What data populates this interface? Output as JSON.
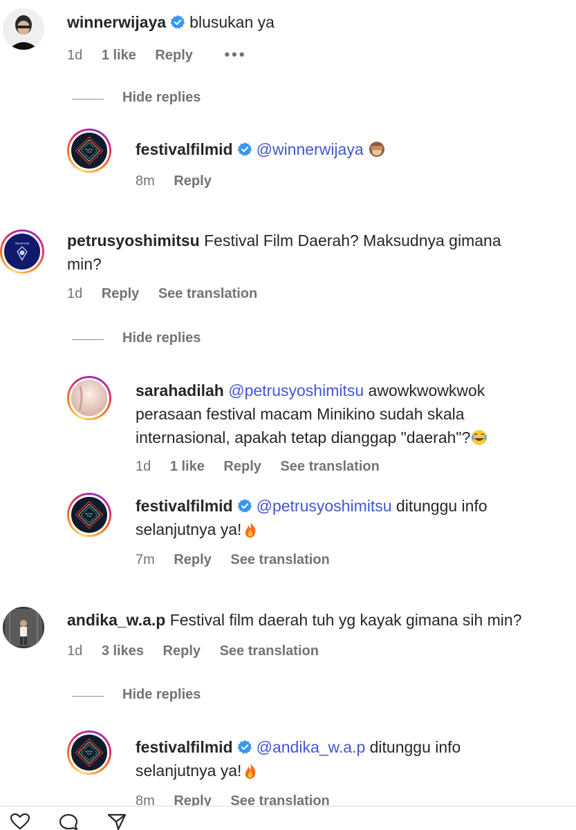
{
  "comments": [
    {
      "username": "winnerwijaya",
      "verified": true,
      "text": "blusukan ya",
      "time": "1d",
      "likes": "1 like",
      "reply": "Reply",
      "more": "•••",
      "hide_replies": "Hide replies",
      "replies": [
        {
          "username": "festivalfilmid",
          "verified": true,
          "mention": "@winnerwijaya",
          "text": "",
          "emoji": "see-no-evil-monkey",
          "time": "8m",
          "reply": "Reply"
        }
      ]
    },
    {
      "username": "petrusyoshimitsu",
      "text_line1": "Festival Film Daerah? Maksudnya gimana",
      "text_line2": "min?",
      "time": "1d",
      "reply": "Reply",
      "translate": "See translation",
      "hide_replies": "Hide replies",
      "replies": [
        {
          "username": "sarahadilah",
          "mention": "@petrusyoshimitsu",
          "line1": "awowkwowkwok",
          "line2": "perasaan festival macam Minikino sudah skala",
          "line3": "internasional, apakah tetap dianggap \"daerah\"?",
          "emoji": "face-with-tears-of-joy",
          "time": "1d",
          "likes": "1 like",
          "reply": "Reply",
          "translate": "See translation"
        },
        {
          "username": "festivalfilmid",
          "verified": true,
          "mention": "@petrusyoshimitsu",
          "line1": "ditunggu info",
          "line2": "selanjutnya ya!",
          "emoji": "fire",
          "time": "7m",
          "reply": "Reply",
          "translate": "See translation"
        }
      ]
    },
    {
      "username": "andika_w.a.p",
      "text": "Festival film daerah tuh yg kayak gimana sih min?",
      "time": "1d",
      "likes": "3 likes",
      "reply": "Reply",
      "translate": "See translation",
      "hide_replies": "Hide replies",
      "replies": [
        {
          "username": "festivalfilmid",
          "verified": true,
          "mention": "@andika_w.a.p",
          "line1": "ditunggu info",
          "line2": "selanjutnya ya!",
          "emoji": "fire",
          "time": "8m",
          "reply": "Reply",
          "translate": "See translation"
        }
      ]
    }
  ],
  "colors": {
    "mention": "#4156d6",
    "verified": "#3897f0",
    "meta": "#737373"
  }
}
